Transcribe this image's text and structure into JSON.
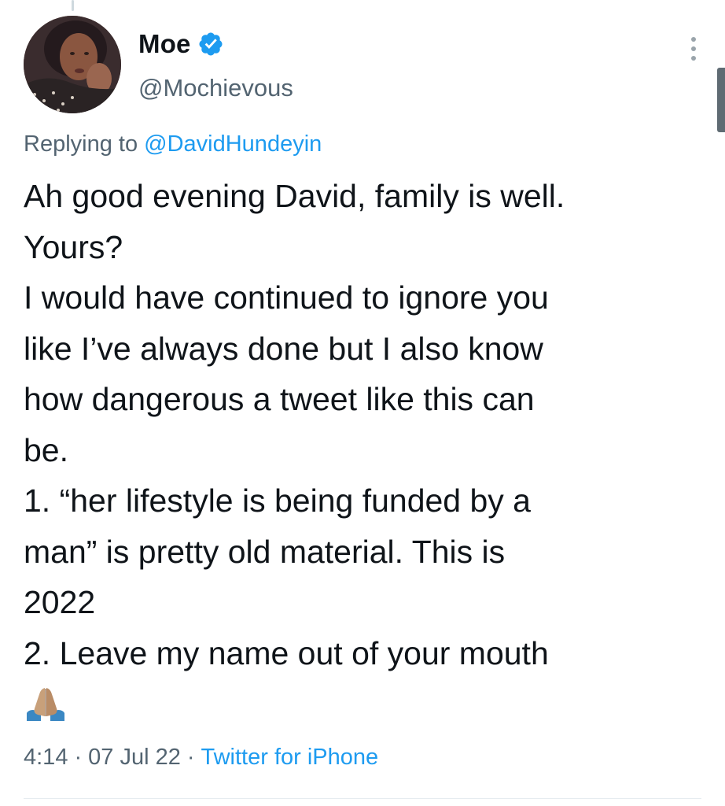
{
  "tweet": {
    "author": {
      "name": "Moe",
      "handle": "@Mochievous",
      "verified": true
    },
    "reply_context": {
      "prefix": "Replying to ",
      "mention": "@DavidHundeyin"
    },
    "lines": [
      "Ah good evening David, family is well.",
      "Yours?",
      "I would have continued to ignore you",
      "like I’ve always done but I also know",
      "how dangerous a tweet like this can",
      "be.",
      "1. “her lifestyle is being funded by a",
      "man” is pretty old material. This is",
      "2022",
      "2. Leave my name out of your mouth"
    ],
    "emoji": "folded-hands",
    "meta": {
      "time": "4:14",
      "date": "07 Jul 22",
      "separator": "·",
      "source": "Twitter for iPhone"
    }
  },
  "icons": {
    "verified": "verified-badge-icon",
    "more": "more-vertical-icon"
  },
  "colors": {
    "text": "#0f1419",
    "secondary": "#536471",
    "link": "#1d9bf0",
    "verified": "#1d9bf0"
  }
}
